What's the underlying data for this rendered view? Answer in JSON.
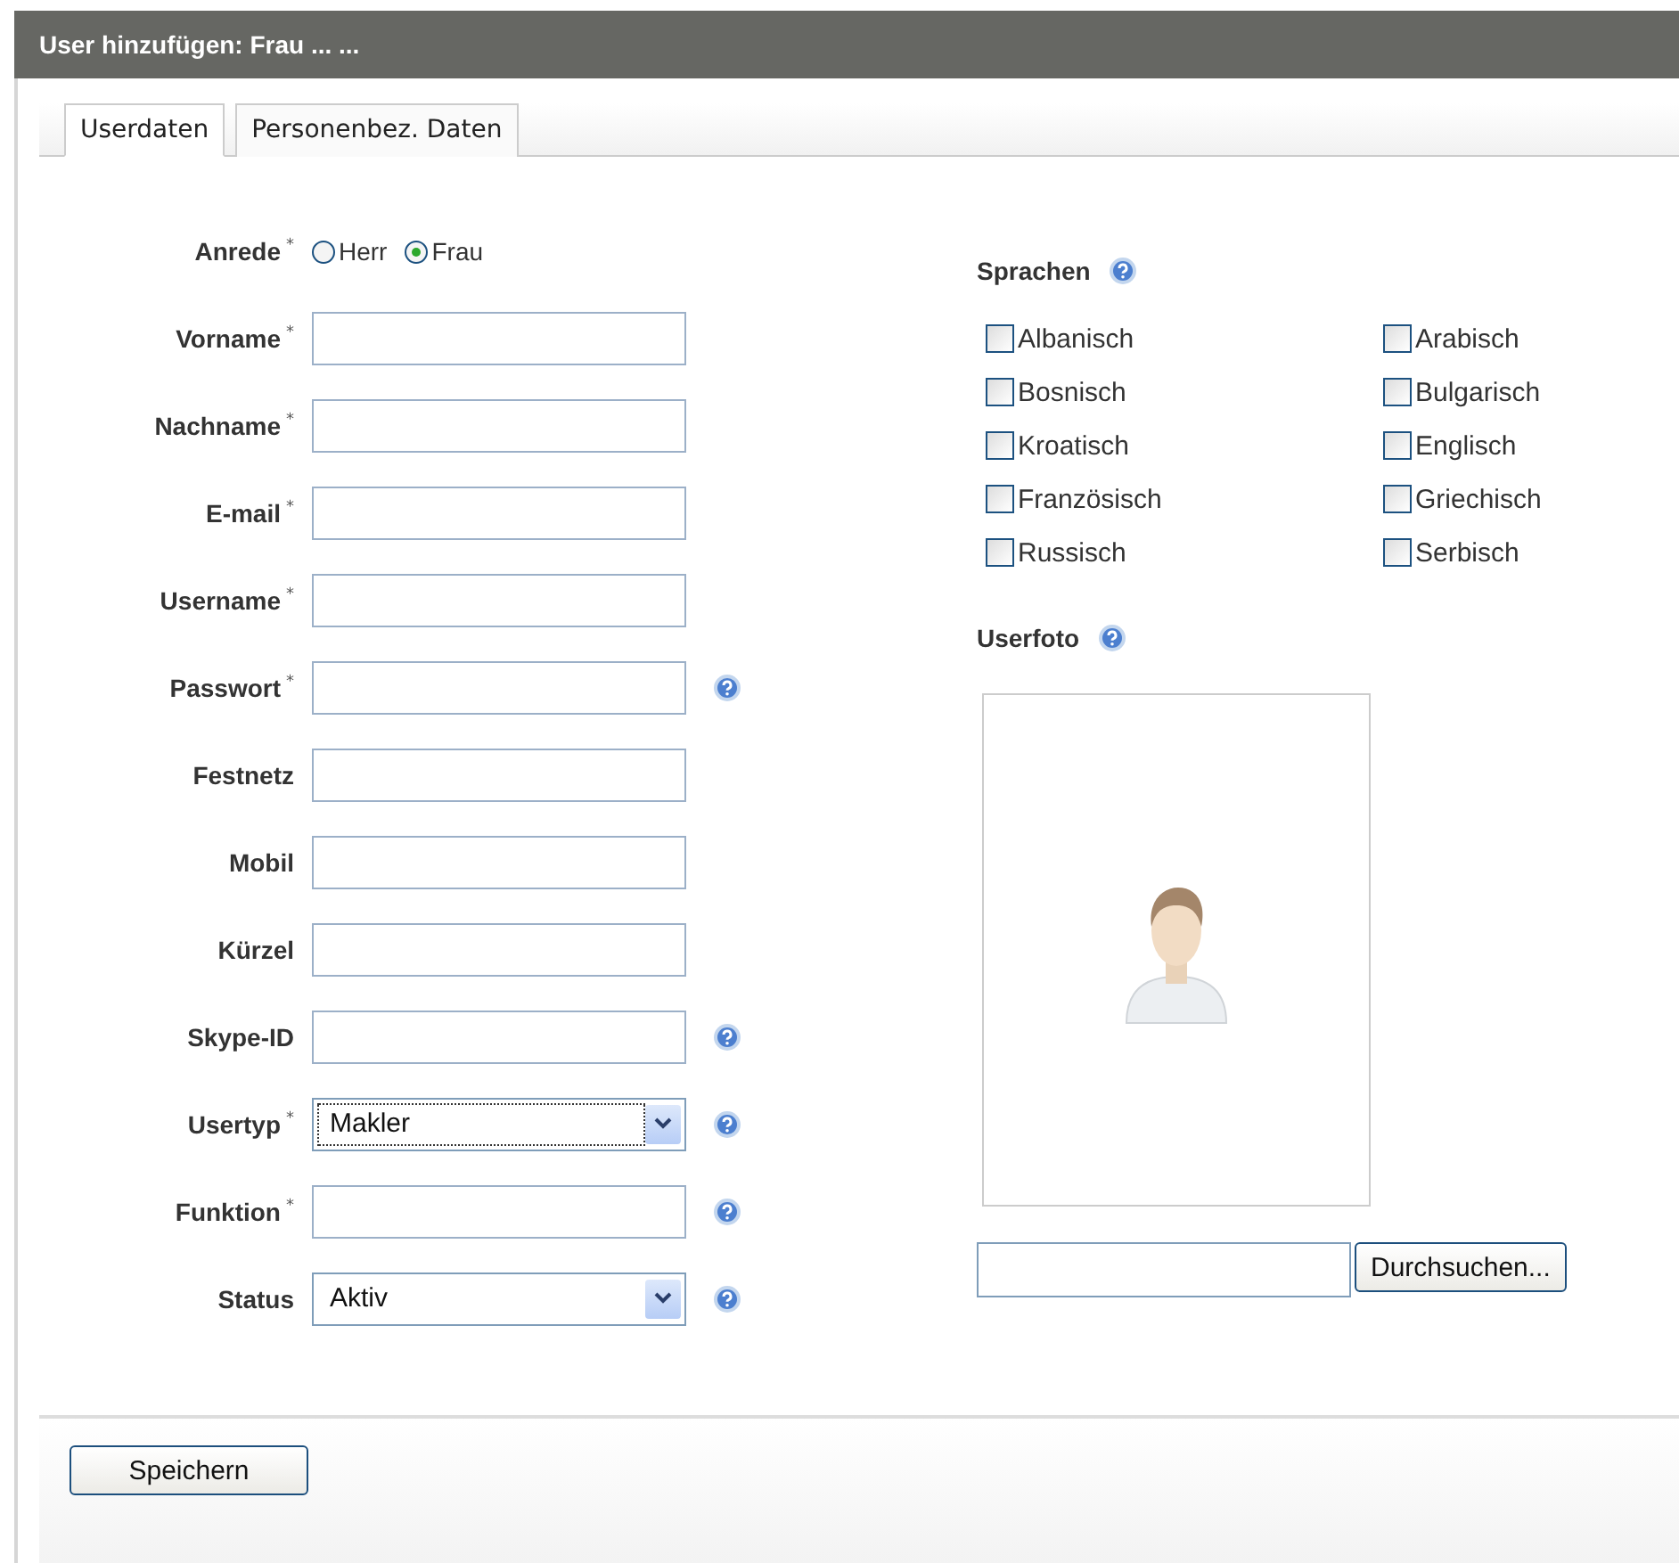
{
  "window": {
    "title": "User hinzufügen: Frau ... ..."
  },
  "tabs": [
    {
      "label": "Userdaten",
      "selected": true
    },
    {
      "label": "Personenbez. Daten",
      "selected": false
    }
  ],
  "fields": [
    {
      "kind": "radio",
      "label": "Anrede",
      "required_mark": "*",
      "options": [
        {
          "label": "Herr",
          "selected": false
        },
        {
          "label": "Frau",
          "selected": true
        }
      ]
    },
    {
      "kind": "text",
      "label": "Vorname",
      "required_mark": "*"
    },
    {
      "kind": "text",
      "label": "Nachname",
      "required_mark": "*"
    },
    {
      "kind": "text",
      "label": "E-mail",
      "required_mark": "*"
    },
    {
      "kind": "text",
      "label": "Username",
      "required_mark": "*"
    },
    {
      "kind": "text",
      "label": "Passwort",
      "required_mark": "*",
      "help": true
    },
    {
      "kind": "text",
      "label": "Festnetz"
    },
    {
      "kind": "text",
      "label": "Mobil"
    },
    {
      "kind": "text",
      "label": "Kürzel"
    },
    {
      "kind": "text",
      "label": "Skype-ID",
      "help": true
    },
    {
      "kind": "select",
      "label": "Usertyp",
      "required_mark": "*",
      "value": "Makler",
      "focused": true,
      "help": true
    },
    {
      "kind": "text",
      "label": "Funktion",
      "required_mark": "*",
      "help": true
    },
    {
      "kind": "select",
      "label": "Status",
      "value": "Aktiv",
      "focused": false,
      "help": true
    }
  ],
  "languages": {
    "title": "Sprachen",
    "help": true,
    "items": [
      {
        "label": "Albanisch",
        "checked": false
      },
      {
        "label": "Arabisch",
        "checked": false
      },
      {
        "label": "Bosnisch",
        "checked": false
      },
      {
        "label": "Bulgarisch",
        "checked": false
      },
      {
        "label": "Kroatisch",
        "checked": false
      },
      {
        "label": "Englisch",
        "checked": false
      },
      {
        "label": "Französisch",
        "checked": false
      },
      {
        "label": "Griechisch",
        "checked": false
      },
      {
        "label": "Russisch",
        "checked": false
      },
      {
        "label": "Serbisch",
        "checked": false
      }
    ]
  },
  "photo": {
    "title": "Userfoto",
    "help": true,
    "browse_button": "Durchsuchen..."
  },
  "save_button": "Speichern"
}
